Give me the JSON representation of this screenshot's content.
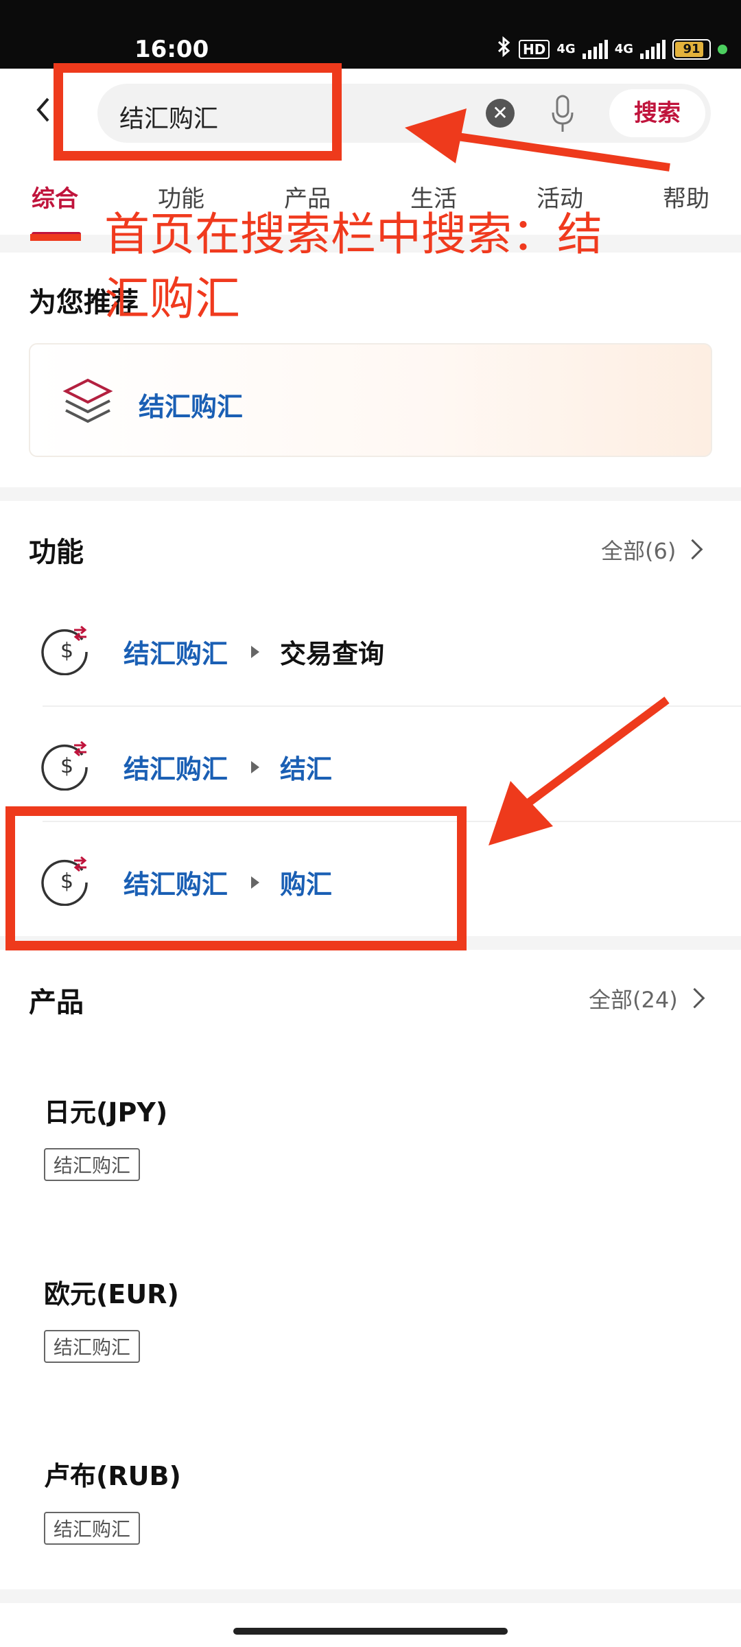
{
  "status_bar": {
    "time": "16:00",
    "hd": "HD",
    "network1": "4G",
    "network2": "4G",
    "battery": "91"
  },
  "search": {
    "value": "结汇购汇",
    "clear_glyph": "✕",
    "button_label": "搜索"
  },
  "tabs": [
    {
      "label": "综合",
      "active": true
    },
    {
      "label": "功能"
    },
    {
      "label": "产品"
    },
    {
      "label": "生活"
    },
    {
      "label": "活动"
    },
    {
      "label": "帮助"
    }
  ],
  "annotation": {
    "text_line1": "首页在搜索栏中搜索：结",
    "text_line2": "汇购汇",
    "color": "#ee3a1c"
  },
  "recommend": {
    "title": "为您推荐",
    "item": {
      "label": "结汇购汇",
      "icon": "layers-icon"
    }
  },
  "functions": {
    "title": "功能",
    "more_label": "全部(6)",
    "items": [
      {
        "main": "结汇购汇",
        "sub": "交易查询",
        "icon": "dollar-exchange-icon"
      },
      {
        "main": "结汇购汇",
        "sub": "结汇",
        "icon": "dollar-exchange-icon"
      },
      {
        "main": "结汇购汇",
        "sub": "购汇",
        "icon": "dollar-exchange-icon"
      }
    ]
  },
  "products": {
    "title": "产品",
    "more_label": "全部(24)",
    "items": [
      {
        "name": "日元(JPY)",
        "tag": "结汇购汇"
      },
      {
        "name": "欧元(EUR)",
        "tag": "结汇购汇"
      },
      {
        "name": "卢布(RUB)",
        "tag": "结汇购汇"
      }
    ]
  },
  "colors": {
    "brand_red": "#c0143c",
    "link_blue": "#1a5fb4",
    "annotation_red": "#ee3a1c"
  }
}
